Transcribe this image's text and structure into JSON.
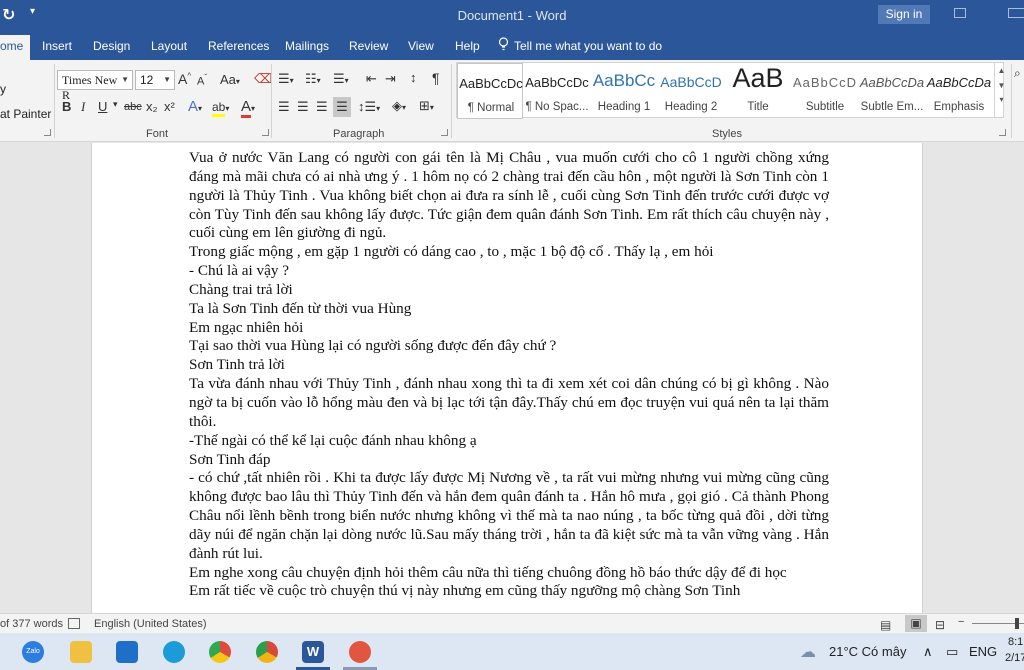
{
  "title_bar": {
    "document_title": "Document1  -  Word",
    "sign_in_label": "Sign in",
    "quick_access_icon": "redo-icon",
    "customize_icon": "customize-quick-access-icon"
  },
  "tabs": [
    {
      "label": "ome",
      "active": true
    },
    {
      "label": "Insert"
    },
    {
      "label": "Design"
    },
    {
      "label": "Layout"
    },
    {
      "label": "References"
    },
    {
      "label": "Mailings"
    },
    {
      "label": "Review"
    },
    {
      "label": "View"
    },
    {
      "label": "Help"
    }
  ],
  "tell_me": "Tell me what you want to do",
  "ribbon": {
    "clipboard": {
      "format_painter": "at Painter"
    },
    "font": {
      "label": "Font",
      "font_name": "Times New R",
      "font_size": "12",
      "grow": "A",
      "shrink": "A",
      "change_case": "Aa",
      "bold": "B",
      "italic": "I",
      "underline": "U",
      "strikethrough": "abc",
      "subscript": "x₂",
      "superscript": "x²",
      "text_effects": "A",
      "highlight": "ab",
      "font_color": "A"
    },
    "paragraph": {
      "label": "Paragraph"
    },
    "styles": {
      "label": "Styles",
      "items": [
        {
          "preview": "AaBbCcDc",
          "name": "¶ Normal"
        },
        {
          "preview": "AaBbCcDc",
          "name": "¶ No Spac..."
        },
        {
          "preview": "AaBbCc",
          "name": "Heading 1"
        },
        {
          "preview": "AaBbCcD",
          "name": "Heading 2"
        },
        {
          "preview": "AaB",
          "name": "Title"
        },
        {
          "preview": "AaBbCcD",
          "name": "Subtitle"
        },
        {
          "preview": "AaBbCcDa",
          "name": "Subtle Em..."
        },
        {
          "preview": "AaBbCcDa",
          "name": "Emphasis"
        }
      ]
    }
  },
  "document": {
    "paragraphs": [
      "Vua ở nước Văn Lang có người con gái tên là Mị Châu , vua muốn cưới cho cô 1 người chồng xứng đáng mà mãi chưa có ai nhà ưng ý . 1 hôm nọ có 2 chàng trai đến cầu hôn , một người là Sơn Tinh còn 1 người là Thủy Tinh . Vua không biết chọn ai đưa ra sính lễ , cuối cùng Sơn Tinh đến trước cưới được vợ còn Tùy Tinh đến sau không lấy được. Tức giận đem quân đánh Sơn Tinh. Em rất thích câu chuyện này , cuối cùng em lên giường đi ngủ.",
      "Trong giấc mộng , em gặp 1 người có dáng cao , to , mặc 1 bộ độ cổ . Thấy lạ , em hỏi",
      "- Chú là ai vậy ?",
      "Chàng trai trả lời",
      "Ta là Sơn Tinh đến từ thời vua Hùng",
      "Em ngạc nhiên hỏi",
      "Tại sao thời vua Hùng lại có người sống được đến đây chứ ?",
      "Sơn Tinh trả lời",
      "Ta vừa đánh nhau với Thủy Tinh , đánh nhau xong thì ta đi xem xét coi dân chúng có bị gì không . Nào ngờ ta bị cuốn vào lỗ hổng màu đen và bị lạc tới tận đây.Thấy chú em đọc truyện vui quá nên ta lại thăm thôi.",
      "-Thế ngài có thể kể lại cuộc đánh nhau không ạ",
      "Sơn Tinh đáp",
      "- có chứ ,tất nhiên rồi . Khi  ta được lấy  được Mị Nương về , ta rất vui mừng nhưng vui mừng cũng cũng không được bao lâu thì Thủy Tinh đến và hắn đem quân đánh ta . Hắn hô mưa , gọi gió . Cả thành Phong Châu nổi lềnh bềnh trong biển nước nhưng không vì thế mà ta nao núng , ta bốc từng quả đồi , dời từng dãy núi để ngăn chặn lại dòng nước lũ.Sau mấy tháng trời , hắn ta đã kiệt sức mà ta vẫn vững vàng . Hắn đành rút lui.",
      "Em nghe xong câu chuyện định hỏi thêm câu nữa thì tiếng chuông đồng hồ báo thức dậy để đi học",
      "Em rất tiếc về cuộc trò chuyện thú vị này nhưng em cũng thấy ngưỡng mộ chàng Sơn Tinh"
    ]
  },
  "status_bar": {
    "word_count": "of 377 words",
    "language": "English (United States)"
  },
  "taskbar": {
    "apps": [
      {
        "name": "zalo",
        "label": "Zalo",
        "color": "#2b7de0"
      },
      {
        "name": "file-explorer",
        "color": "#f0c040"
      },
      {
        "name": "microsoft-store",
        "color": "#1f6fc9"
      },
      {
        "name": "edge",
        "color": "#1b9bd7"
      },
      {
        "name": "chrome",
        "color": "#e04a3a"
      },
      {
        "name": "chrome-profile",
        "color": "#d8493b"
      },
      {
        "name": "word",
        "color": "#2b579a"
      },
      {
        "name": "snip",
        "color": "#e2553f"
      }
    ],
    "weather": "21°C  Có mây",
    "language": "ENG",
    "time": "8:1",
    "date": "2/17"
  },
  "colors": {
    "word_blue": "#2b579a",
    "ribbon_bg": "#f3f3f3",
    "spell_squiggle": "#4a6fd1"
  }
}
